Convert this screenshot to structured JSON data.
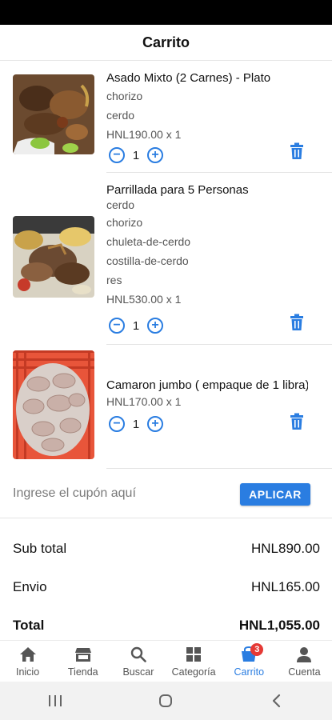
{
  "header": {
    "title": "Carrito"
  },
  "items": [
    {
      "name": "Asado Mixto (2 Carnes) - Plato",
      "options": [
        "chorizo",
        "cerdo"
      ],
      "price": "HNL190.00 x 1",
      "qty": "1"
    },
    {
      "name": "Parrillada para 5 Personas",
      "options": [
        "cerdo",
        "chorizo",
        "chuleta-de-cerdo",
        "costilla-de-cerdo",
        "res"
      ],
      "price": "HNL530.00 x 1",
      "qty": "1"
    },
    {
      "name": "Camaron jumbo ( empaque de 1 libra)",
      "options": [],
      "price": "HNL170.00 x 1",
      "qty": "1"
    }
  ],
  "coupon": {
    "placeholder": "Ingrese el cupón aquí",
    "apply_label": "APLICAR"
  },
  "summary": {
    "subtotal_label": "Sub total",
    "subtotal_value": "HNL890.00",
    "shipping_label": "Envio",
    "shipping_value": "HNL165.00",
    "total_label": "Total",
    "total_value": "HNL1,055.00"
  },
  "nav": {
    "items": [
      {
        "label": "Inicio",
        "icon": "home-icon"
      },
      {
        "label": "Tienda",
        "icon": "store-icon"
      },
      {
        "label": "Buscar",
        "icon": "search-icon"
      },
      {
        "label": "Categoría",
        "icon": "grid-icon"
      },
      {
        "label": "Carrito",
        "icon": "cart-icon",
        "badge": "3"
      },
      {
        "label": "Cuenta",
        "icon": "person-icon"
      }
    ],
    "active": "Carrito"
  },
  "colors": {
    "accent": "#2a7de1",
    "badge": "#e53935"
  }
}
